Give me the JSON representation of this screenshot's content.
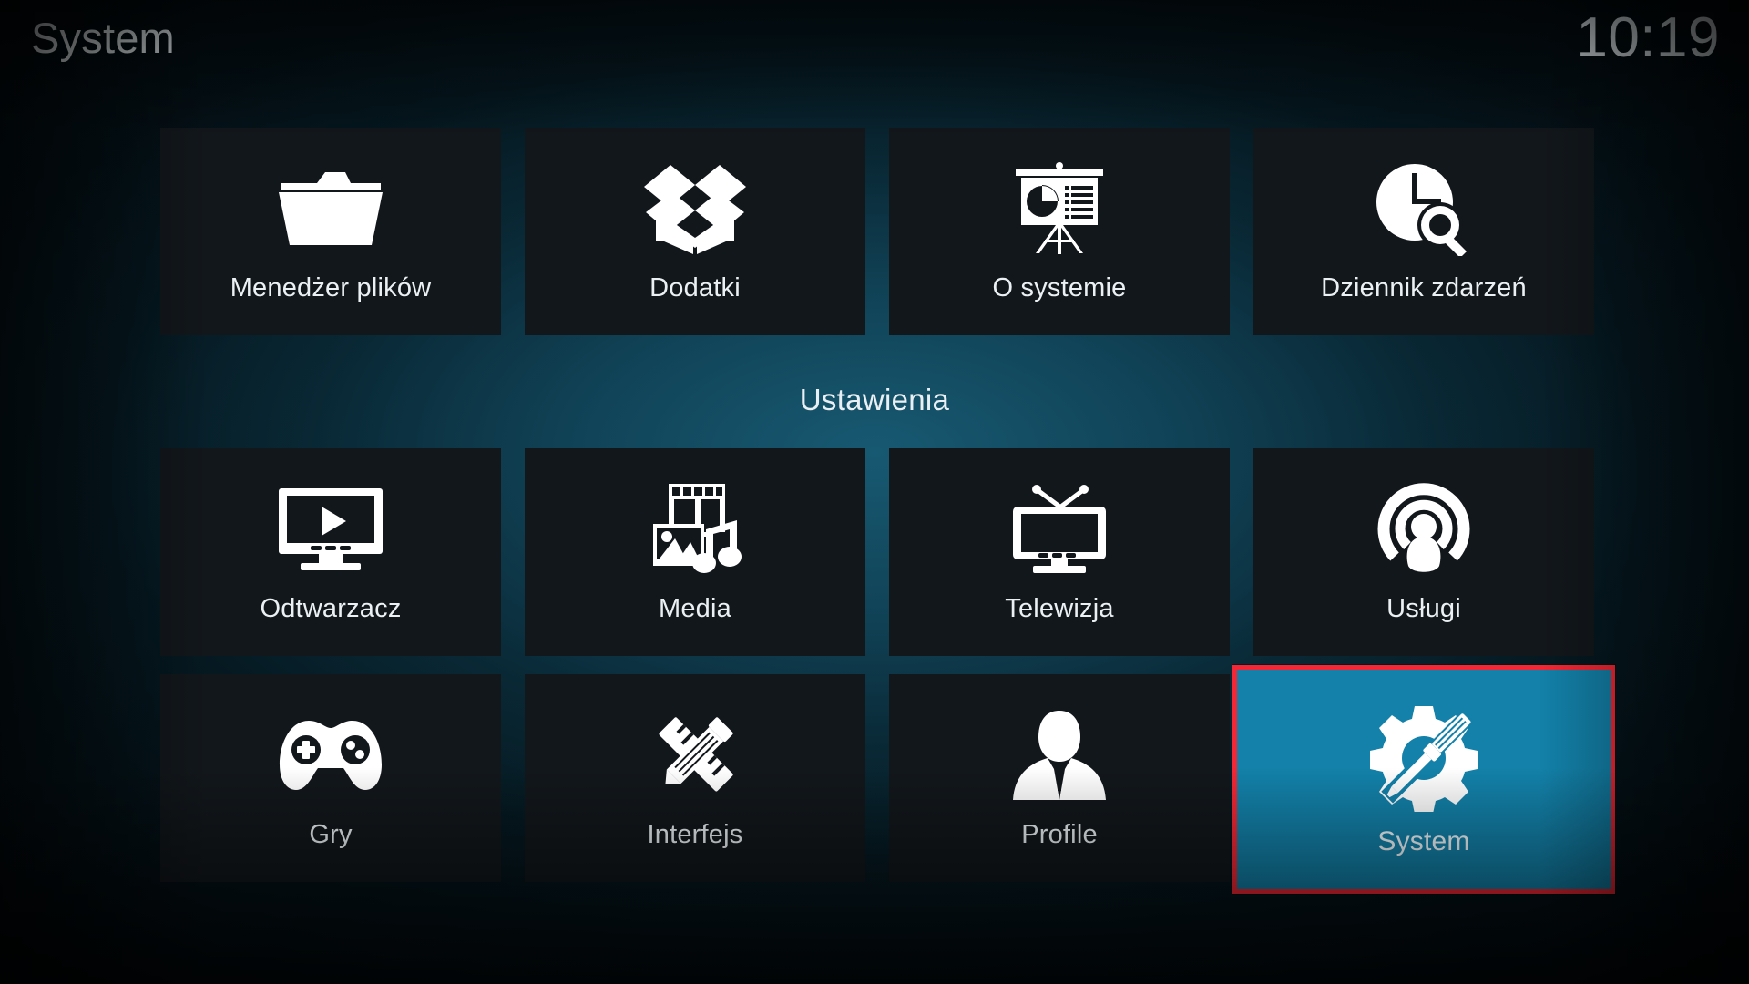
{
  "header": {
    "title": "System",
    "clock": "10:19"
  },
  "section": {
    "label": "Ustawienia"
  },
  "colors": {
    "tile_background": "#12171b",
    "selected_background": "#1381a9",
    "selected_border": "#f32735",
    "text": "#eaf0f3",
    "backdrop_teal": "#185c75"
  },
  "top_row": {
    "items": [
      {
        "label": "Menedżer plików",
        "icon": "folder-icon",
        "selected": false
      },
      {
        "label": "Dodatki",
        "icon": "open-box-icon",
        "selected": false
      },
      {
        "label": "O systemie",
        "icon": "presentation-board-icon",
        "selected": false
      },
      {
        "label": "Dziennik zdarzeń",
        "icon": "clock-search-icon",
        "selected": false
      }
    ]
  },
  "settings_row_1": {
    "items": [
      {
        "label": "Odtwarzacz",
        "icon": "monitor-play-icon",
        "selected": false
      },
      {
        "label": "Media",
        "icon": "film-photo-music-icon",
        "selected": false
      },
      {
        "label": "Telewizja",
        "icon": "tv-antenna-icon",
        "selected": false
      },
      {
        "label": "Usługi",
        "icon": "broadcast-person-icon",
        "selected": false
      }
    ]
  },
  "settings_row_2": {
    "items": [
      {
        "label": "Gry",
        "icon": "gamepad-icon",
        "selected": false
      },
      {
        "label": "Interfejs",
        "icon": "pencil-ruler-icon",
        "selected": false
      },
      {
        "label": "Profile",
        "icon": "person-silhouette-icon",
        "selected": false
      },
      {
        "label": "System",
        "icon": "gear-screwdriver-icon",
        "selected": true
      }
    ]
  }
}
